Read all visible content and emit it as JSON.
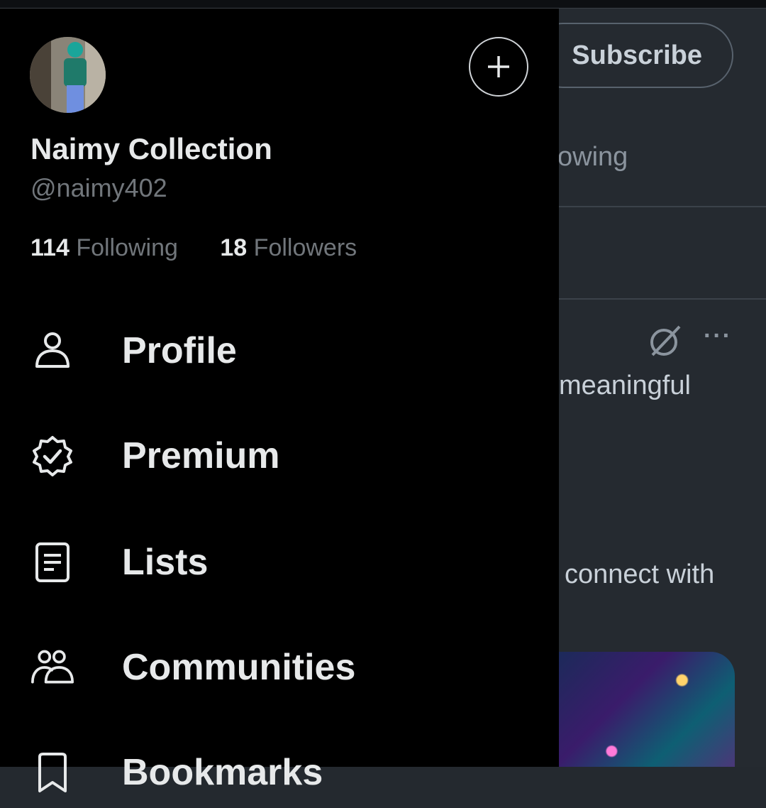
{
  "background": {
    "subscribe_label": "Subscribe",
    "tab_partial": "owing",
    "post_text_partial": "meaningful",
    "post_text_partial_2": "connect with",
    "more_label": "···"
  },
  "drawer": {
    "display_name": "Naimy Collection",
    "handle": "@naimy402",
    "following_count": "114",
    "following_label": "Following",
    "followers_count": "18",
    "followers_label": "Followers",
    "menu": [
      {
        "label": "Profile",
        "icon": "person-icon"
      },
      {
        "label": "Premium",
        "icon": "verified-badge-icon"
      },
      {
        "label": "Lists",
        "icon": "list-icon"
      },
      {
        "label": "Communities",
        "icon": "communities-icon"
      },
      {
        "label": "Bookmarks",
        "icon": "bookmark-icon"
      }
    ]
  },
  "colors": {
    "drawer_bg": "#000000",
    "text_primary": "#e7e9ea",
    "text_secondary": "#71767b",
    "timeline_bg": "#252a30"
  }
}
